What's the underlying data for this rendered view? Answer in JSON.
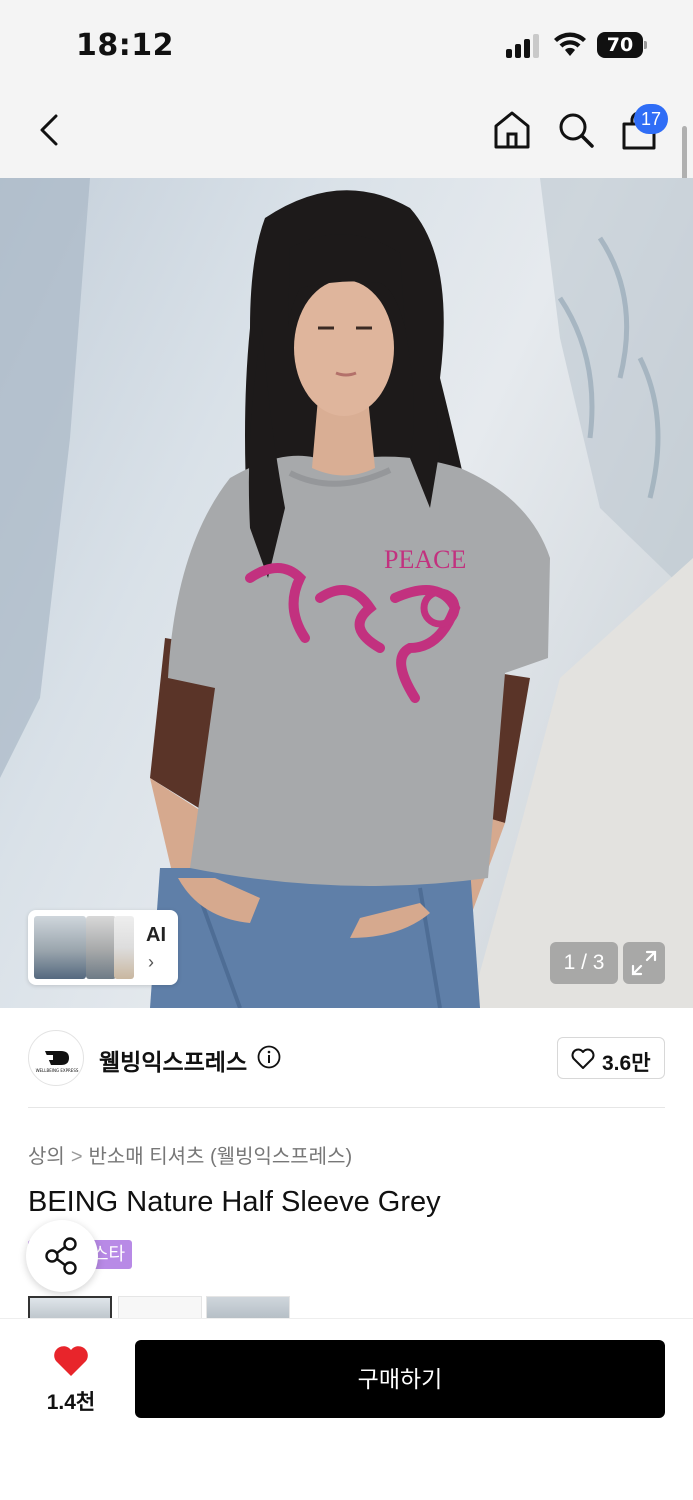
{
  "status_bar": {
    "time": "18:12",
    "battery": "70"
  },
  "nav": {
    "cart_count": "17",
    "icons": [
      "back-arrow-icon",
      "home-icon",
      "search-icon",
      "shopping-bag-icon"
    ]
  },
  "gallery": {
    "ai_label": "AI",
    "ai_chevron": "›",
    "counter": "1 / 3",
    "shirt_print": "PEACE"
  },
  "brand": {
    "name": "웰빙익스프레스",
    "logo_text": "WELLBEING EXPRESS",
    "likes": "3.6만"
  },
  "breadcrumb": {
    "category": "상의",
    "separator": ">",
    "subcategory": "반소매 티셔츠 (웰빙익스프레스)"
  },
  "product": {
    "title": "BEING Nature Half Sleeve Grey",
    "tag": "스타"
  },
  "bottom": {
    "like_count": "1.4천",
    "buy_label": "구매하기"
  },
  "colors": {
    "accent_blue": "#2f6df6",
    "tag_purple": "#b88ae6",
    "heart_red": "#e8252b",
    "buy_black": "#000000"
  }
}
